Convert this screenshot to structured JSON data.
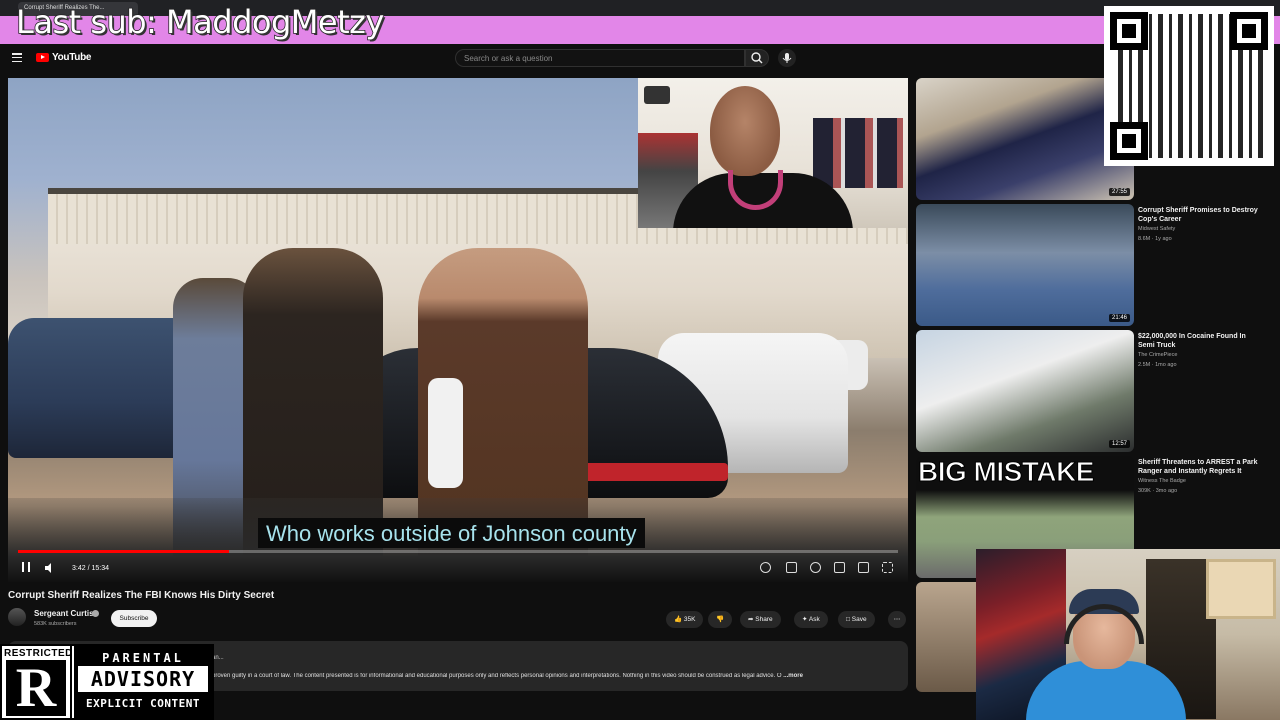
{
  "browser": {
    "tab_title": "Corrupt Sheriff Realizes The..."
  },
  "overlay": {
    "last_sub": "Last sub: MaddogMetzy"
  },
  "header": {
    "logo_text": "YouTube",
    "search_placeholder": "Search or ask a question"
  },
  "video": {
    "caption": "Who works outside of Johnson county",
    "time": "3:42 / 15:34",
    "progress_fraction": 0.24,
    "title": "Corrupt Sheriff Realizes The FBI Knows His Dirty Secret"
  },
  "channel": {
    "name": "Sergeant Curtis",
    "subscribers": "583K subscribers",
    "subscribe_label": "Subscribe"
  },
  "actions": {
    "likes": "35K",
    "share": "Share",
    "ask": "Ask",
    "save": "Save"
  },
  "description": {
    "text": "proven guilty in a court of law. The content presented is for informational and educational purposes only and reflects personal opinions and interpretations. Nothing in this video should be construed as legal advice. O",
    "more": "...more",
    "truncated_start": "an..."
  },
  "related": [
    {
      "title": "",
      "channel": "",
      "meta": "",
      "duration": "27:55"
    },
    {
      "title": "Corrupt Sheriff Promises to Destroy Cop's Career",
      "channel": "Midwest Safety",
      "meta": "8.6M · 1y ago",
      "duration": "21:46"
    },
    {
      "title": "$22,000,000 In Cocaine Found In Semi Truck",
      "channel": "The CrimePiece",
      "meta": "2.5M · 1mo ago",
      "duration": "12:57"
    },
    {
      "title": "Sheriff Threatens to ARREST a Park Ranger and Instantly Regrets It",
      "channel": "Witness The Badge",
      "meta": "309K · 3mo ago",
      "duration": ""
    }
  ],
  "thumb4_text": "BIG MISTAKE",
  "advisory": {
    "restricted": "RESTRICTED",
    "letter": "R",
    "top": "PARENTAL",
    "mid": "ADVISORY",
    "bottom": "EXPLICIT CONTENT"
  },
  "colors": {
    "accent": "#ff0000",
    "banner": "#e286e8",
    "caption_text": "#a7e2ec"
  },
  "icons": [
    "menu-icon",
    "youtube-logo-icon",
    "search-icon",
    "mic-icon",
    "pause-icon",
    "volume-icon",
    "captions-icon",
    "settings-icon",
    "miniplayer-icon",
    "theater-icon",
    "fullscreen-icon",
    "like-icon",
    "dislike-icon",
    "share-icon",
    "ask-icon",
    "save-icon",
    "more-icon"
  ]
}
